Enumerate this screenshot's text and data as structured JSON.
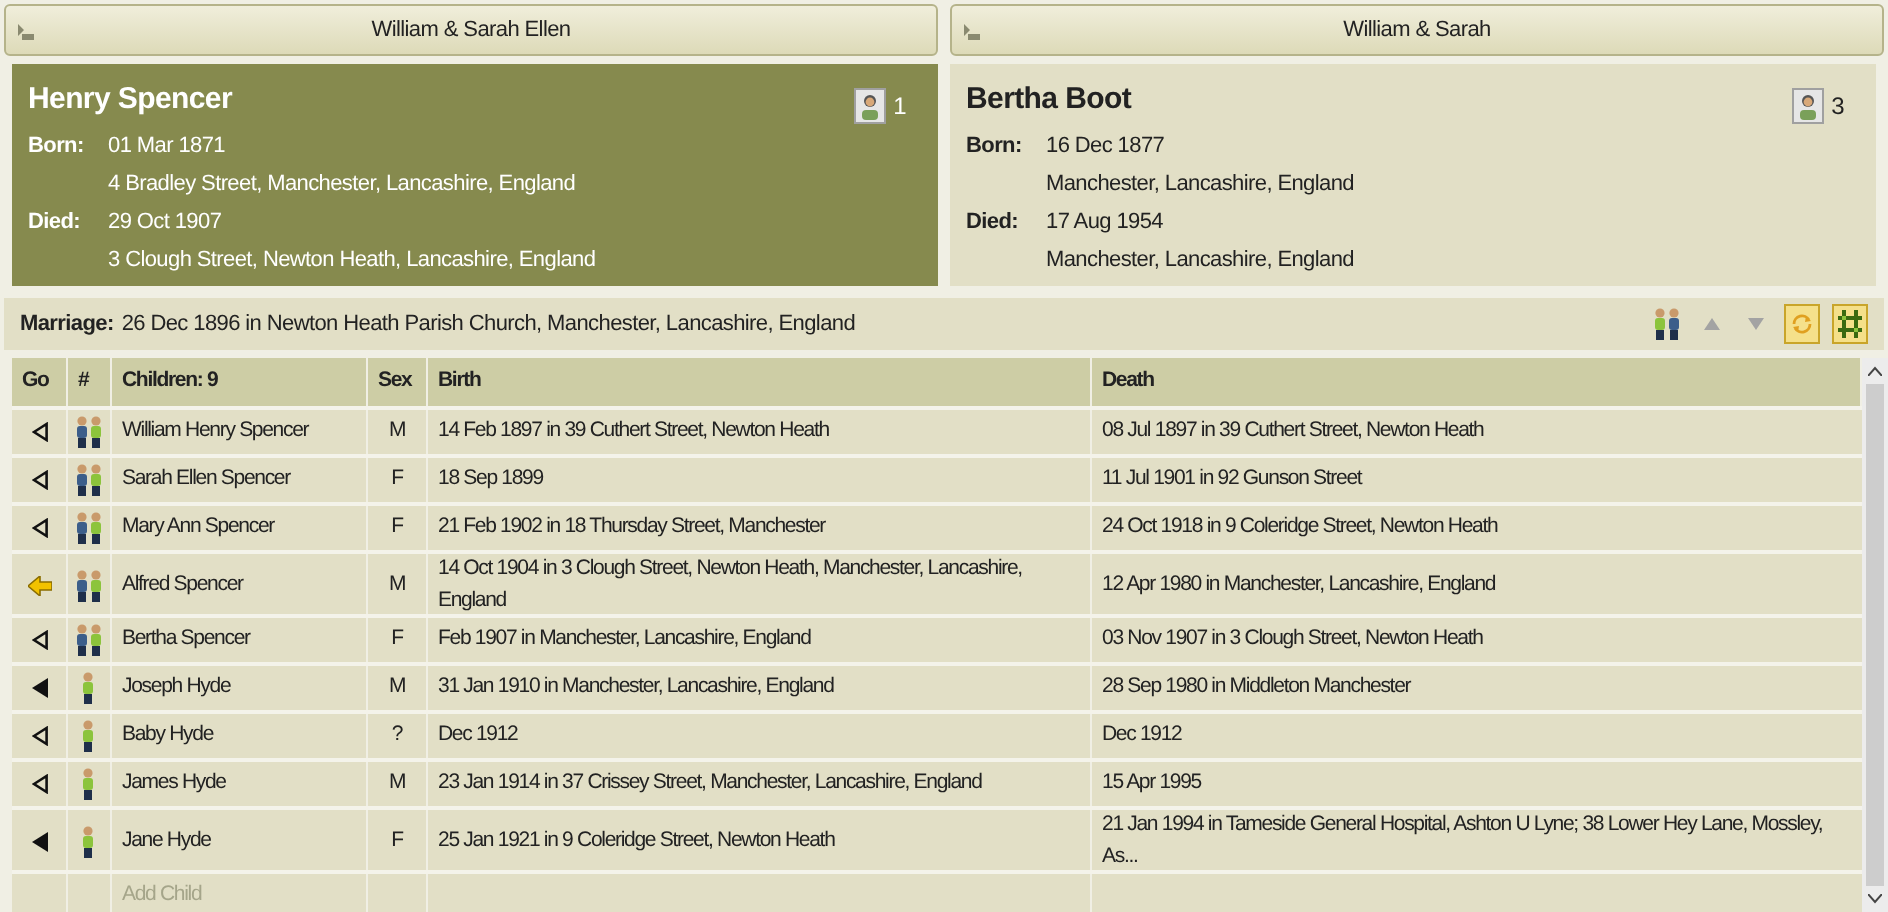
{
  "parents": [
    {
      "header": "William & Sarah Ellen",
      "selected": true,
      "name": "Henry Spencer",
      "born_label": "Born:",
      "born_date": "01 Mar 1871",
      "born_place": "4 Bradley Street, Manchester, Lancashire, England",
      "died_label": "Died:",
      "died_date": "29 Oct 1907",
      "died_place": "3 Clough Street, Newton Heath, Lancashire, England",
      "media_count": "1"
    },
    {
      "header": "William & Sarah",
      "selected": false,
      "name": "Bertha Boot",
      "born_label": "Born:",
      "born_date": "16 Dec 1877",
      "born_place": "Manchester, Lancashire, England",
      "died_label": "Died:",
      "died_date": "17 Aug 1954",
      "died_place": "Manchester, Lancashire, England",
      "media_count": "3"
    }
  ],
  "marriage": {
    "label": "Marriage:",
    "text": "26 Dec 1896 in Newton Heath Parish Church, Manchester, Lancashire, England"
  },
  "toolbar": [
    {
      "kind": "family",
      "on": false
    },
    {
      "kind": "up",
      "on": false
    },
    {
      "kind": "down",
      "on": false
    },
    {
      "kind": "sync",
      "on": true
    },
    {
      "kind": "tree",
      "on": true
    }
  ],
  "table": {
    "columns": [
      "Go",
      "#",
      "Children: 9",
      "Sex",
      "Birth",
      "Death"
    ],
    "rows": [
      {
        "current": false,
        "linked": false,
        "kind": "family",
        "name": "William Henry Spencer",
        "sex": "M",
        "birth": "14 Feb 1897 in 39 Cuthert Street, Newton Heath",
        "death": "08 Jul 1897 in 39 Cuthert Street, Newton Heath"
      },
      {
        "current": false,
        "linked": false,
        "kind": "family",
        "name": "Sarah Ellen Spencer",
        "sex": "F",
        "birth": "18 Sep 1899",
        "death": "11 Jul 1901 in 92 Gunson Street"
      },
      {
        "current": false,
        "linked": false,
        "kind": "family",
        "name": "Mary Ann Spencer",
        "sex": "F",
        "birth": "21 Feb 1902 in 18 Thursday Street, Manchester",
        "death": "24 Oct 1918 in 9 Coleridge Street, Newton Heath"
      },
      {
        "current": true,
        "linked": false,
        "kind": "family",
        "name": "Alfred Spencer",
        "sex": "M",
        "birth": "14 Oct 1904 in 3 Clough Street, Newton Heath, Manchester, Lancashire, England",
        "death": "12 Apr 1980 in Manchester, Lancashire, England"
      },
      {
        "current": false,
        "linked": false,
        "kind": "family",
        "name": "Bertha Spencer",
        "sex": "F",
        "birth": "Feb 1907 in Manchester, Lancashire, England",
        "death": "03 Nov 1907 in 3 Clough Street, Newton Heath"
      },
      {
        "current": false,
        "linked": true,
        "kind": "single",
        "name": "Joseph Hyde",
        "sex": "M",
        "birth": "31 Jan 1910 in Manchester, Lancashire, England",
        "death": "28 Sep 1980 in Middleton Manchester"
      },
      {
        "current": false,
        "linked": false,
        "kind": "single",
        "name": "Baby Hyde",
        "sex": "?",
        "birth": "Dec 1912",
        "death": "Dec 1912"
      },
      {
        "current": false,
        "linked": false,
        "kind": "single",
        "name": "James Hyde",
        "sex": "M",
        "birth": "23 Jan 1914 in 37 Crissey Street, Manchester, Lancashire, England",
        "death": "15 Apr 1995"
      },
      {
        "current": false,
        "linked": true,
        "kind": "single",
        "name": "Jane Hyde",
        "sex": "F",
        "birth": "25 Jan 1921 in 9 Coleridge Street, Newton Heath",
        "death": "21 Jan 1994 in Tameside General Hospital, Ashton U Lyne; 38 Lower Hey Lane, Mossley, As..."
      }
    ],
    "add_child": "Add Child"
  }
}
